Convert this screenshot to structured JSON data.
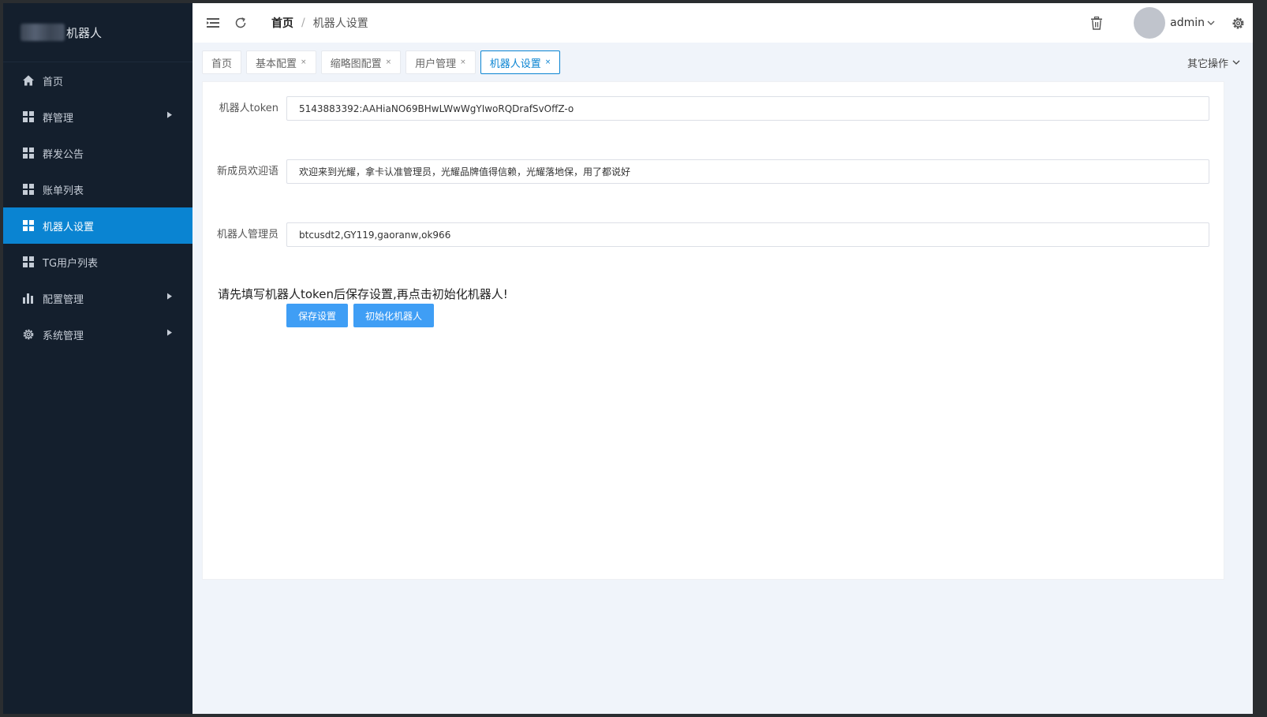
{
  "sidebar": {
    "logo_text": "机器人",
    "items": [
      {
        "label": "首页",
        "icon": "home-icon"
      },
      {
        "label": "群管理",
        "icon": "grid-icon",
        "has_children": true
      },
      {
        "label": "群发公告",
        "icon": "grid-icon"
      },
      {
        "label": "账单列表",
        "icon": "grid-icon"
      },
      {
        "label": "机器人设置",
        "icon": "grid-icon",
        "active": true
      },
      {
        "label": "TG用户列表",
        "icon": "grid-icon"
      },
      {
        "label": "配置管理",
        "icon": "bar-chart-icon",
        "has_children": true
      },
      {
        "label": "系统管理",
        "icon": "gear-icon",
        "has_children": true
      }
    ]
  },
  "header": {
    "breadcrumb_home": "首页",
    "breadcrumb_sep": "/",
    "breadcrumb_current": "机器人设置",
    "username": "admin"
  },
  "tabs": {
    "items": [
      {
        "label": "首页",
        "closable": false
      },
      {
        "label": "基本配置",
        "closable": true
      },
      {
        "label": "缩略图配置",
        "closable": true
      },
      {
        "label": "用户管理",
        "closable": true
      },
      {
        "label": "机器人设置",
        "closable": true,
        "active": true
      }
    ],
    "close_glyph": "×",
    "other_label": "其它操作"
  },
  "form": {
    "token_label": "机器人token",
    "token_value": "5143883392:AAHiaNO69BHwLWwWgYIwoRQDrafSvOffZ-o",
    "welcome_label": "新成员欢迎语",
    "welcome_value": "欢迎来到光耀，拿卡认准管理员，光耀品牌值得信赖，光耀落地保，用了都说好",
    "admins_label": "机器人管理员",
    "admins_value": "btcusdt2,GY119,gaoranw,ok966",
    "notice": "请先填写机器人token后保存设置,再点击初始化机器人!",
    "save_button": "保存设置",
    "init_button": "初始化机器人"
  },
  "colors": {
    "sidebar_bg": "#141f2d",
    "accent": "#0a84d2",
    "button": "#3f9ef5"
  }
}
